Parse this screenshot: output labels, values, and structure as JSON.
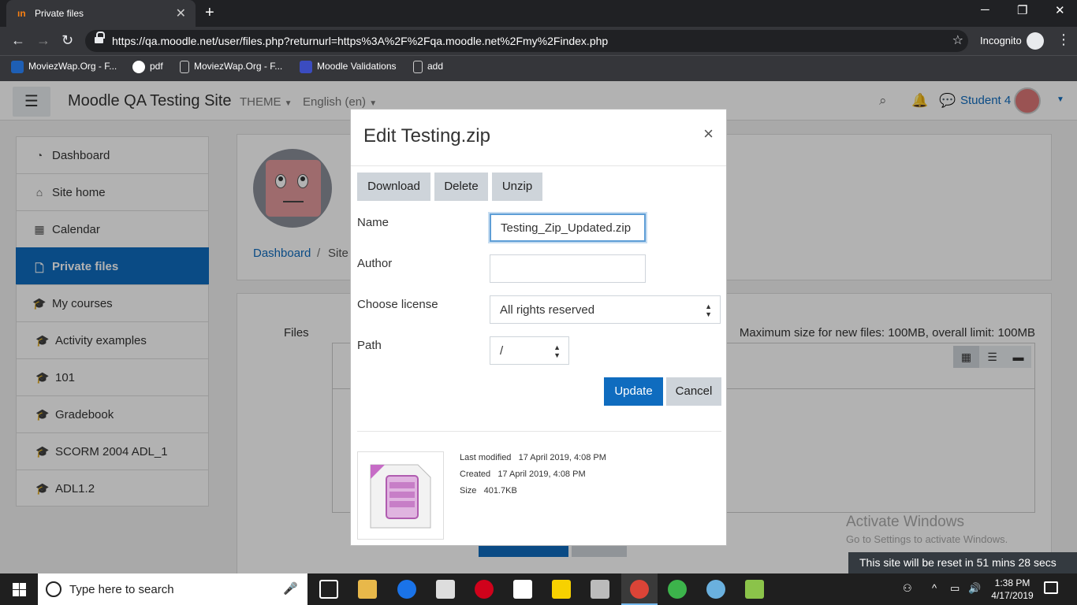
{
  "browser": {
    "tab_title": "Private files",
    "tab_close": "✕",
    "new_tab": "+",
    "url": "https://qa.moodle.net/user/files.php?returnurl=https%3A%2F%2Fqa.moodle.net%2Fmy%2Findex.php",
    "mode": "Incognito",
    "bookmarks": [
      {
        "label": "MoviezWap.Org - F..."
      },
      {
        "label": "pdf"
      },
      {
        "label": "MoviezWap.Org - F..."
      },
      {
        "label": "Moodle Validations"
      },
      {
        "label": "add"
      }
    ]
  },
  "navbar": {
    "site_name": "Moodle QA Testing Site",
    "theme": "THEME",
    "language": "English (en)",
    "user": "Student 4"
  },
  "sidebar": {
    "items": [
      {
        "label": "Dashboard",
        "icon": "dashboard-icon"
      },
      {
        "label": "Site home",
        "icon": "home-icon"
      },
      {
        "label": "Calendar",
        "icon": "calendar-icon"
      },
      {
        "label": "Private files",
        "icon": "file-icon",
        "active": true
      },
      {
        "label": "My courses",
        "icon": "graduation-cap-icon"
      },
      {
        "label": "Activity examples",
        "icon": "graduation-cap-icon"
      },
      {
        "label": "101",
        "icon": "graduation-cap-icon"
      },
      {
        "label": "Gradebook",
        "icon": "graduation-cap-icon"
      },
      {
        "label": "SCORM 2004 ADL_1",
        "icon": "graduation-cap-icon"
      },
      {
        "label": "ADL1.2",
        "icon": "graduation-cap-icon"
      }
    ]
  },
  "page": {
    "breadcrumb_1": "Dashboard",
    "breadcrumb_sep": "/",
    "breadcrumb_2": "Site",
    "files_label": "Files",
    "max_size": "Maximum size for new files: 100MB, overall limit: 100MB"
  },
  "dialog": {
    "title": "Edit Testing.zip",
    "close": "×",
    "buttons": {
      "download": "Download",
      "delete": "Delete",
      "unzip": "Unzip"
    },
    "name_label": "Name",
    "name_value": "Testing_Zip_Updated.zip",
    "author_label": "Author",
    "author_value": "",
    "license_label": "Choose license",
    "license_value": "All rights reserved",
    "path_label": "Path",
    "path_value": "/",
    "update": "Update",
    "cancel": "Cancel",
    "meta": {
      "modified_label": "Last modified",
      "modified_value": "17 April 2019, 4:08 PM",
      "created_label": "Created",
      "created_value": "17 April 2019, 4:08 PM",
      "size_label": "Size",
      "size_value": "401.7KB"
    }
  },
  "watermark": {
    "line1": "Activate Windows",
    "line2": "Go to Settings to activate Windows."
  },
  "reset_banner": "This site will be reset in 51 mins 28 secs",
  "taskbar": {
    "search_placeholder": "Type here to search",
    "time": "1:38 PM",
    "date": "4/17/2019"
  },
  "colors": {
    "moodle_blue": "#0f6cbf",
    "moodle_orange": "#f98012",
    "chrome_dark": "#202124"
  }
}
